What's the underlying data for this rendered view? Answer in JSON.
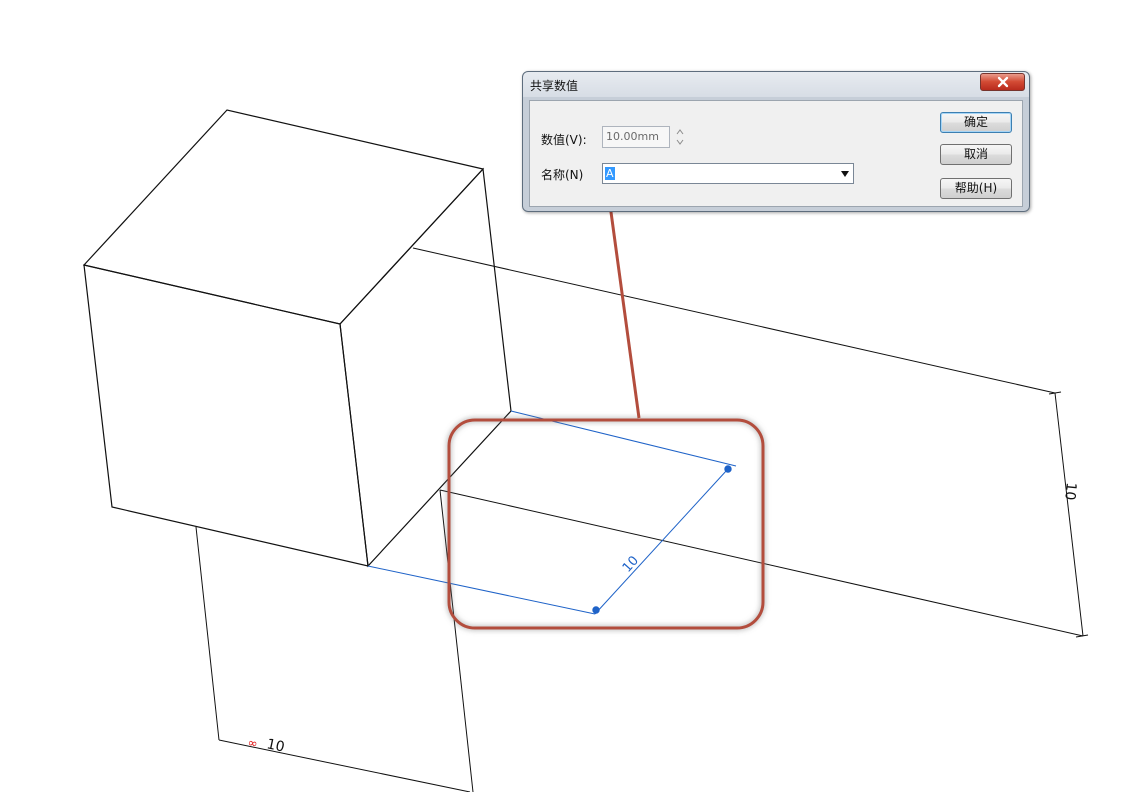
{
  "dialog": {
    "title": "共享数值",
    "value_label": "数值(V):",
    "value_text": "10.00mm",
    "name_label": "名称(N)",
    "name_value": "A",
    "buttons": {
      "ok": "确定",
      "cancel": "取消",
      "help": "帮助(H)"
    },
    "close_icon": "close-icon"
  },
  "cad_view": {
    "dimension_labels": {
      "right_vertical": "10",
      "center_blue": "10",
      "bottom": "10"
    },
    "colors": {
      "model_lines": "#111111",
      "sketch_blue": "#1f63c8",
      "callout_red": "#b34d3d",
      "bottom_marker_red": "#e01616"
    }
  }
}
